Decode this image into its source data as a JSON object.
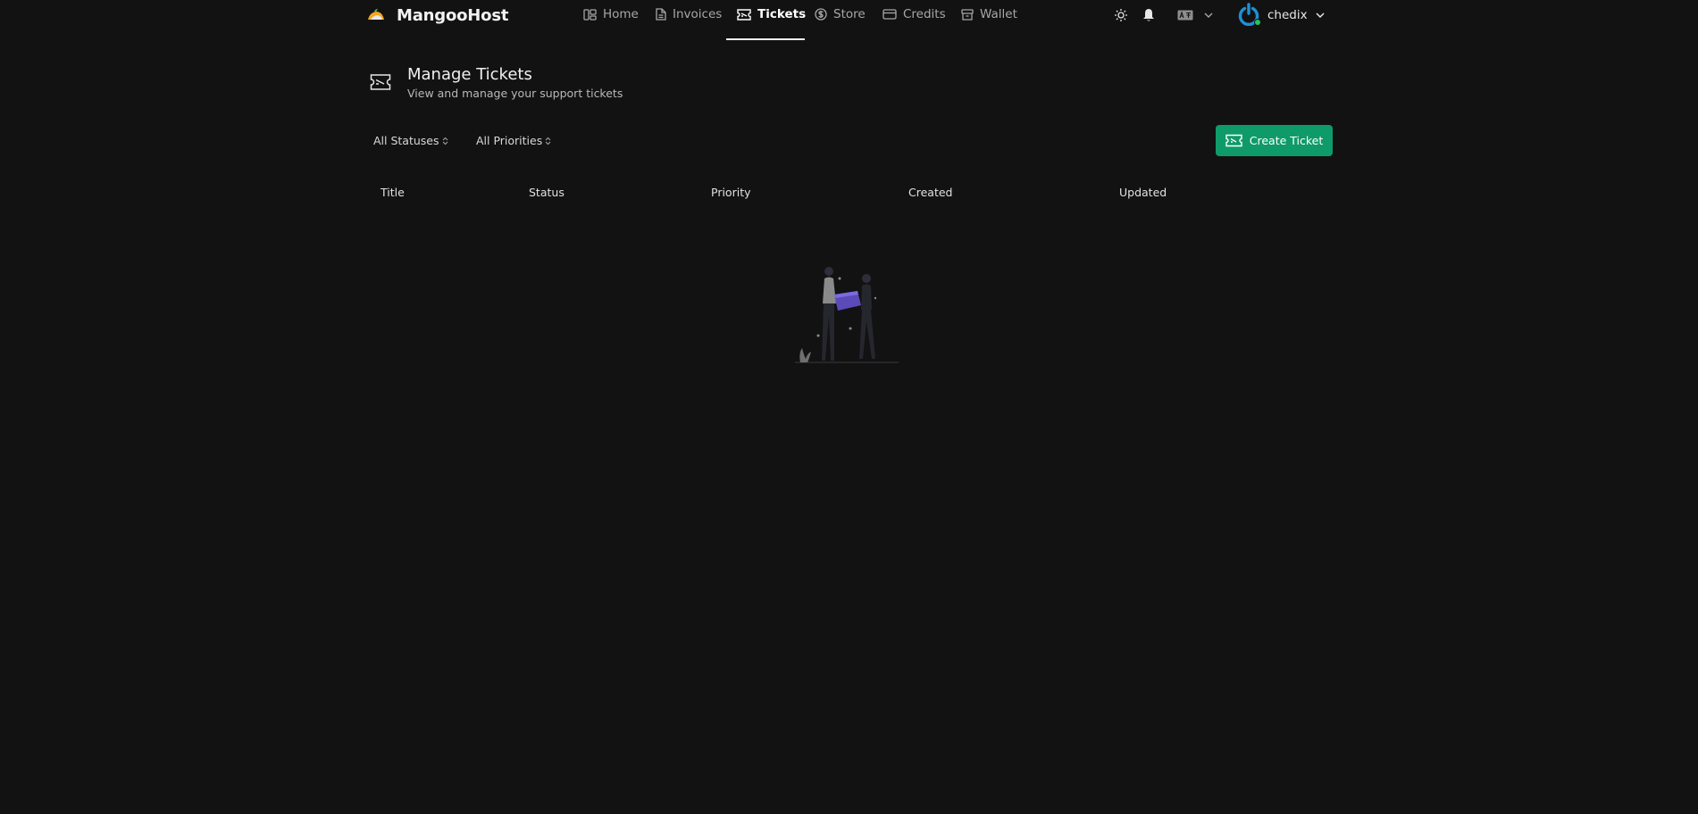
{
  "brand": {
    "name": "MangooHost"
  },
  "nav": {
    "items": [
      {
        "label": "Home",
        "icon": "home-icon"
      },
      {
        "label": "Invoices",
        "icon": "file-icon"
      },
      {
        "label": "Tickets",
        "icon": "ticket-icon",
        "active": true
      },
      {
        "label": "Store",
        "icon": "dollar-icon"
      },
      {
        "label": "Credits",
        "icon": "credit-card-icon"
      },
      {
        "label": "Wallet",
        "icon": "wallet-icon"
      }
    ]
  },
  "utilities": {
    "theme_icon": "sun-icon",
    "notifications_icon": "bell-icon",
    "language_icon": "language-icon"
  },
  "user": {
    "name": "chedix",
    "status_color": "#22c55e",
    "avatar_color": "#1e90d6"
  },
  "page": {
    "title": "Manage Tickets",
    "subtitle": "View and manage your support tickets"
  },
  "filters": {
    "status": {
      "selected": "All Statuses"
    },
    "priority": {
      "selected": "All Priorities"
    }
  },
  "actions": {
    "create_ticket_label": "Create Ticket"
  },
  "table": {
    "columns": [
      "Title",
      "Status",
      "Priority",
      "Created",
      "Updated"
    ],
    "rows": []
  },
  "colors": {
    "background": "#121212",
    "accent": "#0f9a6a",
    "text": "#e6e6e6",
    "muted": "#a7a7a7"
  }
}
